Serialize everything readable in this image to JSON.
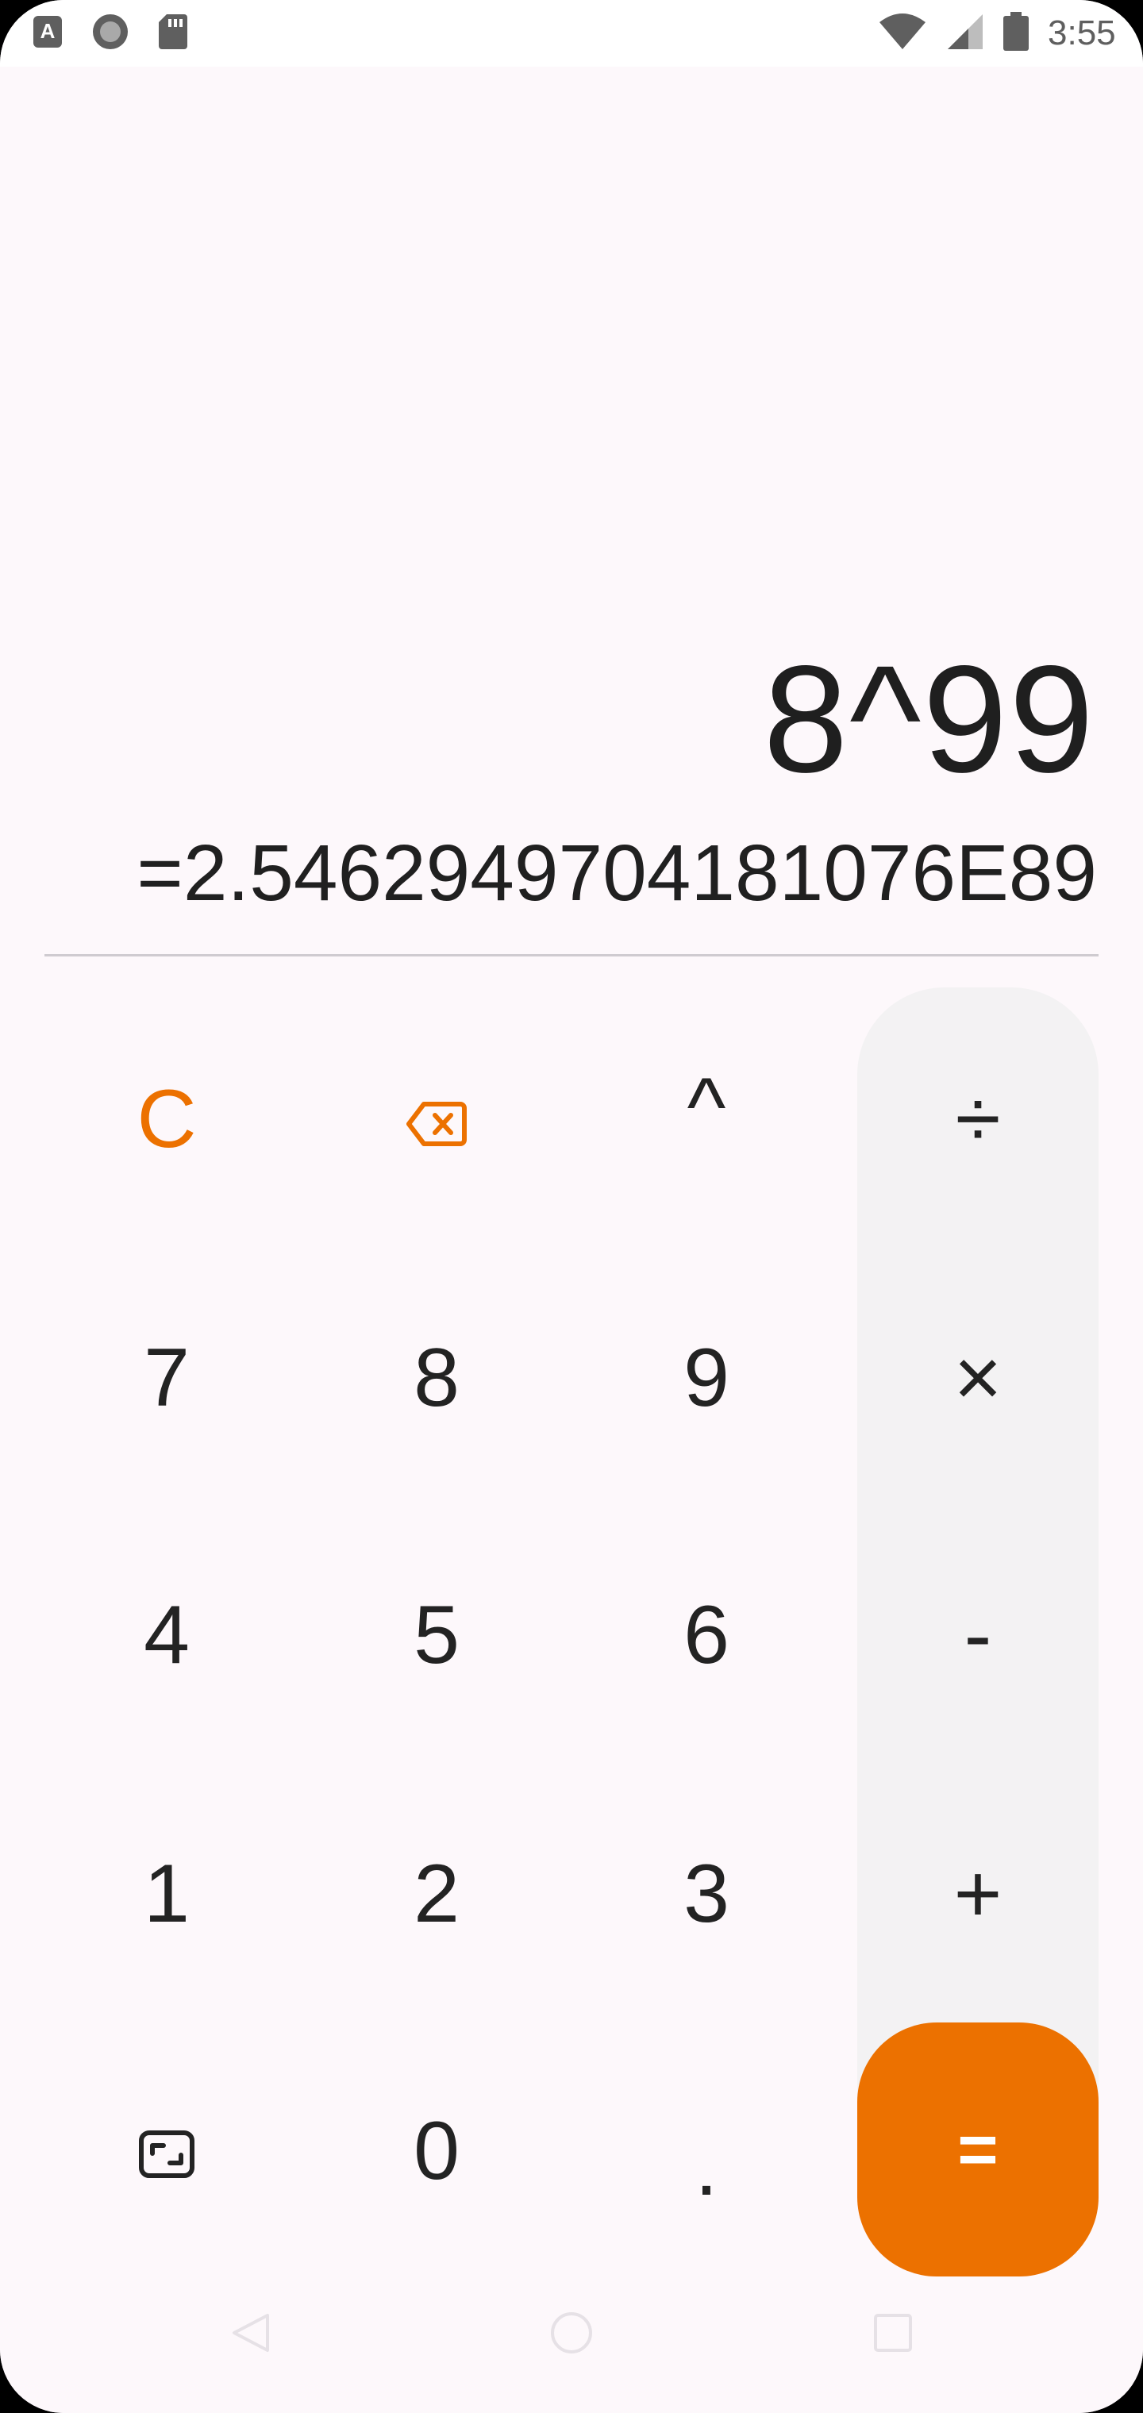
{
  "status_bar": {
    "time": "3:55",
    "icons_left": [
      "text-a-icon",
      "circle-record-icon",
      "sd-card-icon"
    ],
    "icons_right": [
      "wifi-icon",
      "cell-signal-icon",
      "battery-icon"
    ]
  },
  "display": {
    "expression": "8^99",
    "result": "=2.5462949704181076E89"
  },
  "keys": {
    "clear": "C",
    "backspace_icon": "backspace-icon",
    "power": "^",
    "divide": "÷",
    "seven": "7",
    "eight": "8",
    "nine": "9",
    "multiply": "×",
    "four": "4",
    "five": "5",
    "six": "6",
    "subtract": "-",
    "one": "1",
    "two": "2",
    "three": "3",
    "add": "+",
    "toggle_icon": "expand-mode-icon",
    "zero": "0",
    "decimal": ".",
    "equals": "="
  },
  "colors": {
    "accent": "#ec7100",
    "background": "#fdf8fb",
    "operator_column": "#f3f2f3",
    "text": "#232323"
  },
  "nav_bar": {
    "icons": [
      "back-icon",
      "home-icon",
      "recents-icon"
    ]
  }
}
